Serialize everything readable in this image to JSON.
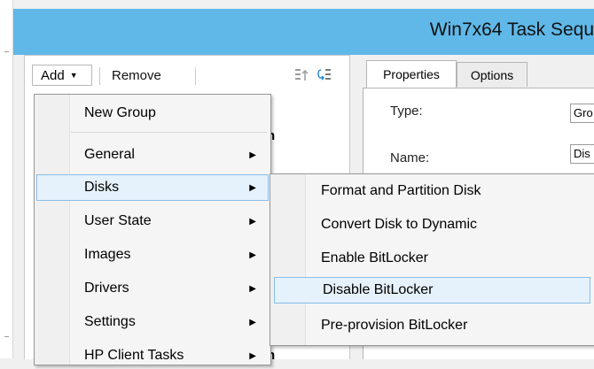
{
  "window": {
    "title": "Win7x64 Task Sequ"
  },
  "toolbar": {
    "add_label": "Add",
    "remove_label": "Remove"
  },
  "tabs": [
    {
      "label": "Properties",
      "active": true
    },
    {
      "label": "Options",
      "active": false
    }
  ],
  "properties": {
    "type_label": "Type:",
    "type_value": "Gro",
    "name_label": "Name:",
    "name_value": "Dis"
  },
  "background_fragments": {
    "first": "n",
    "second": "n"
  },
  "add_menu": {
    "items": [
      {
        "label": "New Group",
        "has_submenu": false
      },
      {
        "label": "General",
        "has_submenu": true
      },
      {
        "label": "Disks",
        "has_submenu": true,
        "highlighted": true
      },
      {
        "label": "User State",
        "has_submenu": true
      },
      {
        "label": "Images",
        "has_submenu": true
      },
      {
        "label": "Drivers",
        "has_submenu": true
      },
      {
        "label": "Settings",
        "has_submenu": true
      },
      {
        "label": "HP Client Tasks",
        "has_submenu": true
      }
    ]
  },
  "disks_submenu": {
    "items": [
      {
        "label": "Format and Partition Disk"
      },
      {
        "label": "Convert Disk to Dynamic"
      },
      {
        "label": "Enable BitLocker"
      },
      {
        "label": "Disable BitLocker",
        "highlighted": true
      },
      {
        "label": "Pre-provision BitLocker"
      }
    ]
  },
  "colors": {
    "titlebar": "#5fb8e8",
    "highlight_bg": "#e5f1fb",
    "highlight_border": "#89bde8"
  },
  "icons": {
    "submenu_arrow": "arrow-right-icon",
    "dropdown": "caret-down-icon"
  }
}
